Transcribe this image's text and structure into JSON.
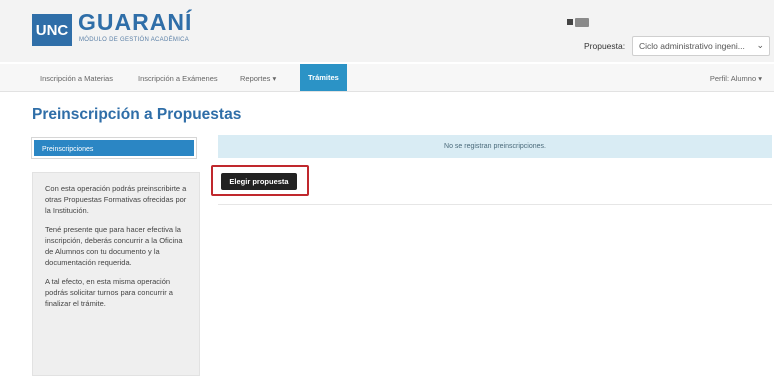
{
  "header": {
    "logo_mark": "UNC",
    "logo_title": "GUARANÍ",
    "logo_subtitle": "MÓDULO DE GESTIÓN ACADÉMICA",
    "propuesta_label": "Propuesta:",
    "propuesta_value": "Ciclo administrativo ingeni..."
  },
  "navbar": {
    "items": [
      {
        "label": "Inscripción a Materias"
      },
      {
        "label": "Inscripción a Exámenes"
      },
      {
        "label": "Reportes ▾"
      },
      {
        "label": "Trámites"
      }
    ],
    "perfil": "Perfil: Alumno ▾"
  },
  "page": {
    "title": "Preinscripción a Propuestas"
  },
  "sidebar": {
    "tab_label": "Preinscripciones",
    "info": [
      "Con esta operación podrás preinscribirte a otras Propuestas Formativas ofrecidas por la Institución.",
      "Tené presente que para hacer efectiva la inscripción, deberás concurrir a la Oficina de Alumnos con tu documento y la documentación requerida.",
      "A tal efecto, en esta misma operación podrás solicitar turnos para concurrir a finalizar el trámite."
    ]
  },
  "main": {
    "empty_message": "No se registran preinscripciones.",
    "choose_button": "Elegir propuesta"
  },
  "colors": {
    "brand_blue": "#2f6ea8",
    "nav_active": "#2b93c6",
    "highlight_border": "#c0282d"
  }
}
